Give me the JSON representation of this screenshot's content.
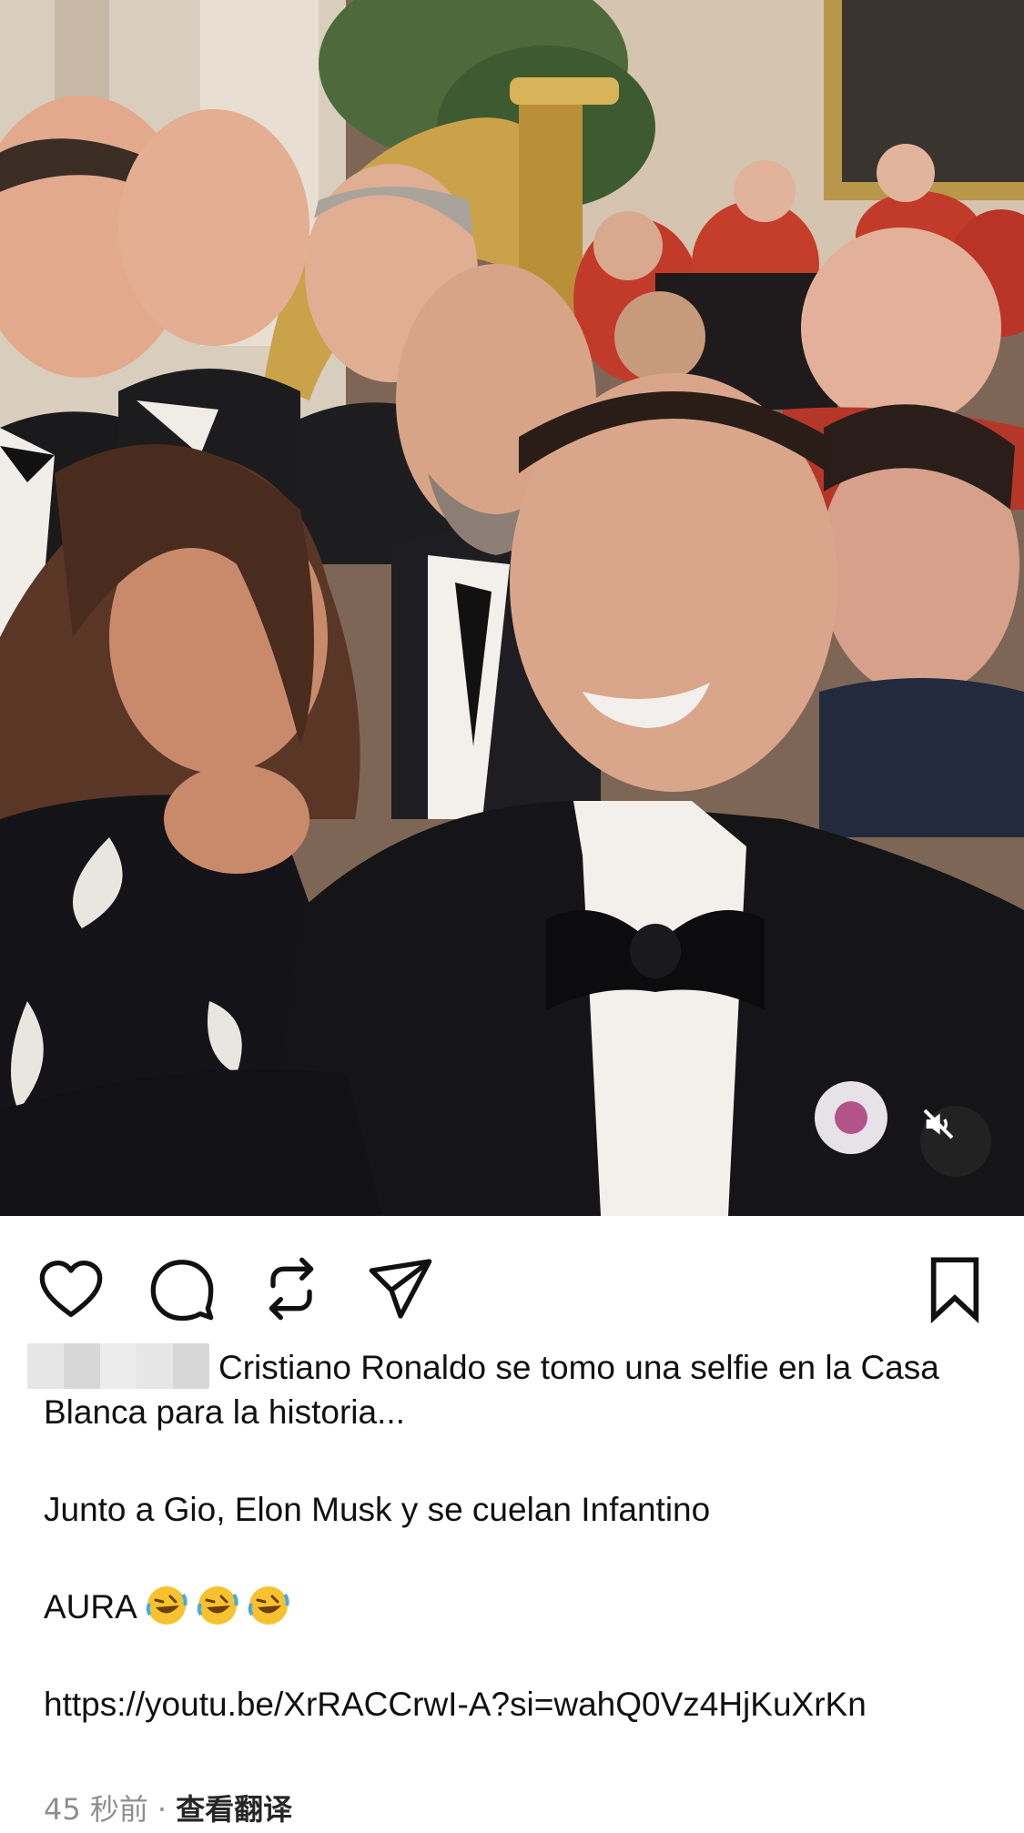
{
  "media": {
    "type": "video",
    "mute_icon": "speaker-muted-icon",
    "description_colors": {
      "tuxedo": "#141414",
      "shirt": "#f3efea",
      "uniform": "#c23b2a",
      "harp_gold": "#c9a24a",
      "wall": "#d8cbbd"
    }
  },
  "actions": {
    "like_icon": "heart-icon",
    "comment_icon": "comment-bubble-icon",
    "repost_icon": "repost-icon",
    "share_icon": "paper-plane-icon",
    "save_icon": "bookmark-icon"
  },
  "caption": {
    "line1": "Cristiano Ronaldo se tomo una selfie en la Casa Blanca para la historia...",
    "line2": "Junto a Gio, Elon Musk y se cuelan Infantino",
    "line3": "AURA",
    "emoji": "rolling-on-floor-laughing",
    "link": "https://youtu.be/XrRACCrwI-A?si=wahQ0Vz4HjKuXrKn"
  },
  "meta": {
    "time": "45 秒前",
    "separator": "·",
    "translate": "查看翻译"
  }
}
